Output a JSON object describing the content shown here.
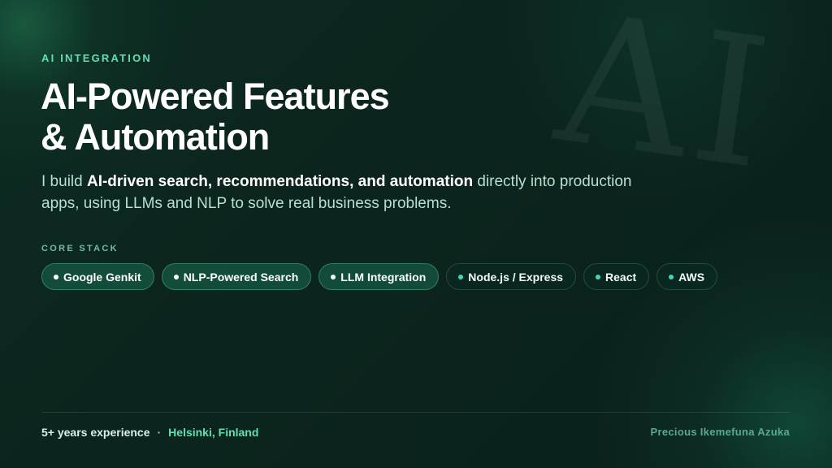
{
  "watermark": {
    "text": "AI"
  },
  "hero": {
    "eyebrow": "AI INTEGRATION",
    "title_lines": [
      "AI-Powered Features",
      "& Automation"
    ],
    "description": {
      "prefix": "I build ",
      "highlight": "AI-driven search, recommendations, and automation",
      "suffix": " directly into production apps, using LLMs and NLP to solve real business problems."
    }
  },
  "core_stack": {
    "label": "CORE STACK",
    "chips": [
      {
        "label": "Google Genkit",
        "variant": "primary"
      },
      {
        "label": "NLP-Powered Search",
        "variant": "primary"
      },
      {
        "label": "LLM Integration",
        "variant": "primary"
      },
      {
        "label": "Node.js / Express",
        "variant": "secondary"
      },
      {
        "label": "React",
        "variant": "secondary"
      },
      {
        "label": "AWS",
        "variant": "secondary"
      }
    ]
  },
  "footer": {
    "experience": "5+ years experience",
    "separator": "·",
    "location": "Helsinki, Finland",
    "name": "Precious Ikemefuna Azuka"
  },
  "colors": {
    "accent": "#5ee0b4",
    "muted_text": "#b8dfd4",
    "dot_secondary": "#43d6bb"
  }
}
